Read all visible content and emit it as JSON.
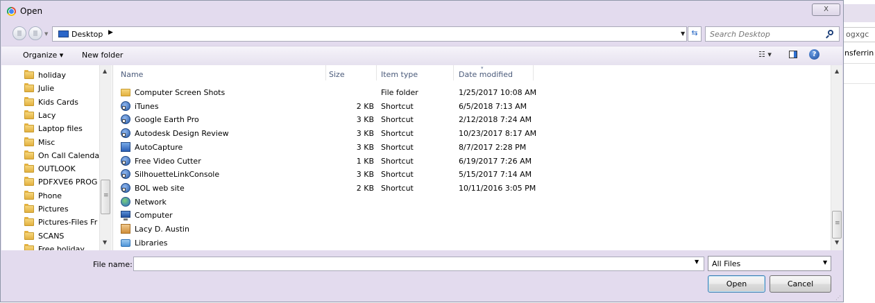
{
  "window": {
    "title": "Open",
    "close_glyph": "X"
  },
  "background_app": {
    "search_fragment": "ogxgc",
    "text_fragment": "nsferrin"
  },
  "address": {
    "location": "Desktop",
    "search_placeholder": "Search Desktop"
  },
  "toolbar": {
    "organize": "Organize ▾",
    "new_folder": "New folder",
    "views": "☷ ▾",
    "help": "?"
  },
  "nav": {
    "items": [
      "holiday",
      "Julie",
      "Kids Cards",
      "Lacy",
      "Laptop files",
      "Misc",
      "On Call Calendar",
      "OUTLOOK",
      "PDFXVE6 PROG",
      "Phone",
      "Pictures",
      "Pictures-Files Fr",
      "SCANS",
      "Free holiday"
    ]
  },
  "columns": {
    "name": "Name",
    "size": "Size",
    "type": "Item type",
    "date": "Date modified"
  },
  "files": [
    {
      "name": "Computer Screen Shots",
      "size": "",
      "type": "File folder",
      "date": "1/25/2017 10:08 AM",
      "icon": "folder-icon"
    },
    {
      "name": "iTunes",
      "size": "2 KB",
      "type": "Shortcut",
      "date": "6/5/2018 7:13 AM",
      "icon": "shortcut-icon"
    },
    {
      "name": "Google Earth Pro",
      "size": "3 KB",
      "type": "Shortcut",
      "date": "2/12/2018 7:24 AM",
      "icon": "shortcut-icon"
    },
    {
      "name": "Autodesk Design Review",
      "size": "3 KB",
      "type": "Shortcut",
      "date": "10/23/2017 8:17 AM",
      "icon": "shortcut-icon"
    },
    {
      "name": "AutoCapture",
      "size": "3 KB",
      "type": "Shortcut",
      "date": "8/7/2017 2:28 PM",
      "icon": "autocapture-icon"
    },
    {
      "name": "Free Video Cutter",
      "size": "1 KB",
      "type": "Shortcut",
      "date": "6/19/2017 7:26 AM",
      "icon": "shortcut-icon"
    },
    {
      "name": "SilhouetteLinkConsole",
      "size": "3 KB",
      "type": "Shortcut",
      "date": "5/15/2017 7:14 AM",
      "icon": "shortcut-icon"
    },
    {
      "name": "BOL web site",
      "size": "2 KB",
      "type": "Shortcut",
      "date": "10/11/2016 3:05 PM",
      "icon": "shortcut-icon"
    },
    {
      "name": "Network",
      "size": "",
      "type": "",
      "date": "",
      "icon": "network-icon"
    },
    {
      "name": "Computer",
      "size": "",
      "type": "",
      "date": "",
      "icon": "computer-icon"
    },
    {
      "name": "Lacy D. Austin",
      "size": "",
      "type": "",
      "date": "",
      "icon": "user-folder-icon"
    },
    {
      "name": "Libraries",
      "size": "",
      "type": "",
      "date": "",
      "icon": "libraries-icon"
    }
  ],
  "bottom": {
    "file_name_label": "File name:",
    "file_name_value": "",
    "filter_selected": "All Files",
    "open_label": "Open",
    "cancel_label": "Cancel"
  }
}
